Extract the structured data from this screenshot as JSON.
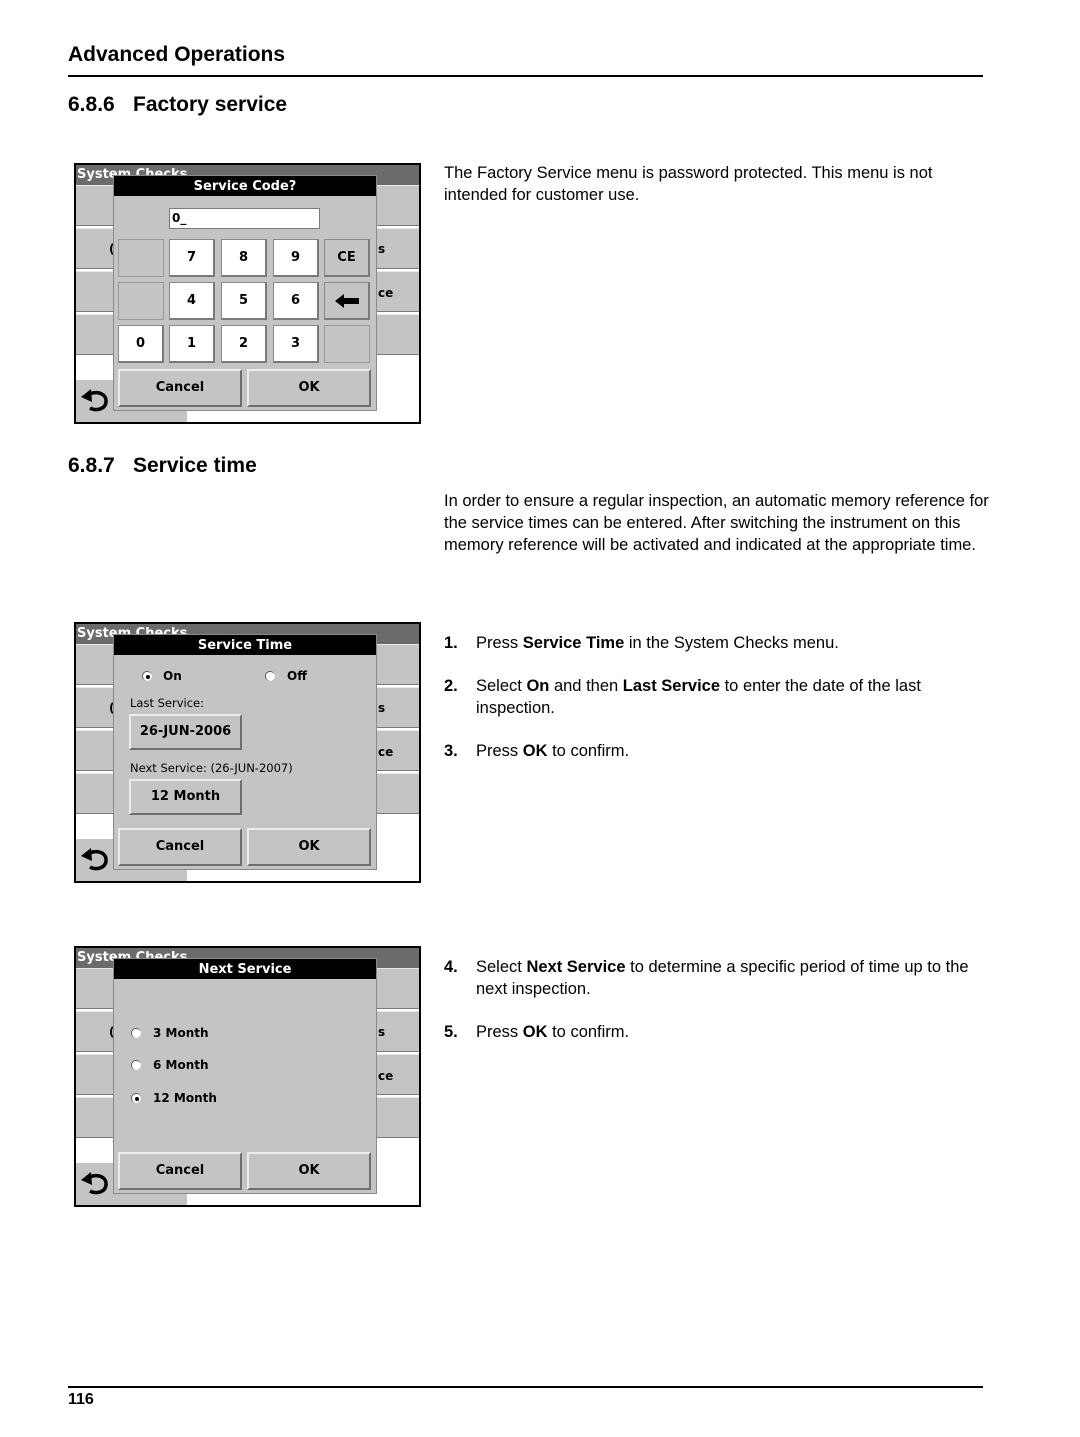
{
  "header": {
    "title": "Advanced Operations"
  },
  "sections": [
    {
      "number": "6.8.6",
      "title": "Factory service"
    },
    {
      "number": "6.8.7",
      "title": "Service time"
    }
  ],
  "factory_service": {
    "description": "The Factory Service menu is password protected. This menu is not intended for customer use.",
    "screen": {
      "background_title": "System Checks",
      "background_fragments": [
        "(",
        "s",
        "ce"
      ],
      "dialog_title": "Service Code?",
      "code_value": "0_",
      "keys": {
        "row1": [
          "",
          "7",
          "8",
          "9",
          "CE"
        ],
        "row2": [
          "",
          "4",
          "5",
          "6",
          "backspace"
        ],
        "row3": [
          "0",
          "1",
          "2",
          "3",
          ""
        ]
      },
      "cancel_label": "Cancel",
      "ok_label": "OK",
      "back_icon": "back-arrow-icon"
    }
  },
  "service_time": {
    "description": "In order to ensure a regular inspection, an automatic memory reference for the service times can be entered. After switching the instrument on this memory reference will be activated and indicated at the appropriate time.",
    "steps": [
      {
        "n": "1.",
        "parts": [
          {
            "t": "Press "
          },
          {
            "b": "Service Time"
          },
          {
            "t": " in the System Checks menu."
          }
        ]
      },
      {
        "n": "2.",
        "parts": [
          {
            "t": "Select "
          },
          {
            "b": "On"
          },
          {
            "t": " and then "
          },
          {
            "b": "Last Service"
          },
          {
            "t": " to enter the date of the last inspection."
          }
        ]
      },
      {
        "n": "3.",
        "parts": [
          {
            "t": "Press "
          },
          {
            "b": "OK"
          },
          {
            "t": " to confirm."
          }
        ]
      },
      {
        "n": "4.",
        "parts": [
          {
            "t": "Select "
          },
          {
            "b": "Next Service"
          },
          {
            "t": " to determine a specific period of time up to the next inspection."
          }
        ]
      },
      {
        "n": "5.",
        "parts": [
          {
            "t": "Press "
          },
          {
            "b": "OK"
          },
          {
            "t": " to confirm."
          }
        ]
      }
    ],
    "screen1": {
      "background_title": "System Checks",
      "dialog_title": "Service Time",
      "radio_on": "On",
      "radio_off": "Off",
      "selected": "On",
      "last_service_label": "Last Service:",
      "last_service_value": "26-JUN-2006",
      "next_service_label": "Next Service: (26-JUN-2007)",
      "next_service_value": "12 Month",
      "cancel_label": "Cancel",
      "ok_label": "OK"
    },
    "screen2": {
      "background_title": "System Checks",
      "dialog_title": "Next Service",
      "options": [
        "3 Month",
        "6 Month",
        "12 Month"
      ],
      "selected": "12 Month",
      "cancel_label": "Cancel",
      "ok_label": "OK"
    }
  },
  "footer": {
    "page_number": "116"
  }
}
